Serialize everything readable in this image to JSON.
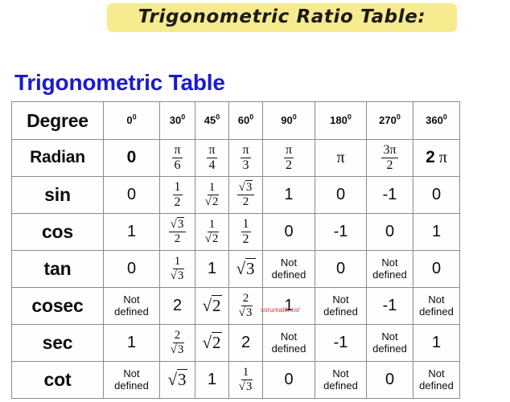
{
  "banner": {
    "title": "Trigonometric Ratio Table:",
    "highlight_color": "#f6eb8f"
  },
  "heading": {
    "text": "Trigonometric Table",
    "color": "#1a1ad0"
  },
  "watermark": {
    "text": "sorumatik.co/",
    "color": "#d4313b"
  },
  "table": {
    "columns": [
      {
        "label": "Degree",
        "value": "",
        "sup": ""
      },
      {
        "label": "0",
        "sup": "0"
      },
      {
        "label": "30",
        "sup": "0"
      },
      {
        "label": "45",
        "sup": "0"
      },
      {
        "label": "60",
        "sup": "0"
      },
      {
        "label": "90",
        "sup": "0"
      },
      {
        "label": "180",
        "sup": "0"
      },
      {
        "label": "270",
        "sup": "0"
      },
      {
        "label": "360",
        "sup": "0"
      }
    ],
    "rows": [
      {
        "label": "Radian",
        "cells": [
          {
            "kind": "plain-bold",
            "text": "0"
          },
          {
            "kind": "frac",
            "num": "π",
            "den": "6"
          },
          {
            "kind": "frac",
            "num": "π",
            "den": "4"
          },
          {
            "kind": "frac",
            "num": "π",
            "den": "3"
          },
          {
            "kind": "frac",
            "num": "π",
            "den": "2"
          },
          {
            "kind": "pi",
            "text": "π"
          },
          {
            "kind": "frac",
            "num": "3π",
            "den": "2"
          },
          {
            "kind": "twopi",
            "text": "2",
            "pi": "π"
          }
        ]
      },
      {
        "label": "sin",
        "cells": [
          {
            "kind": "plain",
            "text": "0"
          },
          {
            "kind": "frac",
            "num": "1",
            "den": "2"
          },
          {
            "kind": "frac-radical-den",
            "num": "1",
            "den": "2"
          },
          {
            "kind": "frac-radical-num",
            "num": "3",
            "den": "2"
          },
          {
            "kind": "plain",
            "text": "1"
          },
          {
            "kind": "plain",
            "text": "0"
          },
          {
            "kind": "plain",
            "text": "-1"
          },
          {
            "kind": "plain",
            "text": "0"
          }
        ]
      },
      {
        "label": "cos",
        "cells": [
          {
            "kind": "plain",
            "text": "1"
          },
          {
            "kind": "frac-radical-num",
            "num": "3",
            "den": "2"
          },
          {
            "kind": "frac-radical-den",
            "num": "1",
            "den": "2"
          },
          {
            "kind": "frac",
            "num": "1",
            "den": "2"
          },
          {
            "kind": "plain",
            "text": "0"
          },
          {
            "kind": "plain",
            "text": "-1"
          },
          {
            "kind": "plain",
            "text": "0"
          },
          {
            "kind": "plain",
            "text": "1"
          }
        ]
      },
      {
        "label": "tan",
        "cells": [
          {
            "kind": "plain",
            "text": "0"
          },
          {
            "kind": "frac-radical-den",
            "num": "1",
            "den": "3"
          },
          {
            "kind": "plain",
            "text": "1"
          },
          {
            "kind": "radical",
            "text": "3"
          },
          {
            "kind": "notdef",
            "line1": "Not",
            "line2": "defined"
          },
          {
            "kind": "plain",
            "text": "0"
          },
          {
            "kind": "notdef",
            "line1": "Not",
            "line2": "defined"
          },
          {
            "kind": "plain",
            "text": "0"
          }
        ]
      },
      {
        "label": "cosec",
        "cells": [
          {
            "kind": "notdef",
            "line1": "Not",
            "line2": "defined"
          },
          {
            "kind": "plain",
            "text": "2"
          },
          {
            "kind": "radical",
            "text": "2"
          },
          {
            "kind": "frac-radical-den",
            "num": "2",
            "den": "3"
          },
          {
            "kind": "plain",
            "text": "1"
          },
          {
            "kind": "notdef",
            "line1": "Not",
            "line2": "defined"
          },
          {
            "kind": "plain",
            "text": "-1"
          },
          {
            "kind": "notdef",
            "line1": "Not",
            "line2": "defined"
          }
        ]
      },
      {
        "label": "sec",
        "cells": [
          {
            "kind": "plain",
            "text": "1"
          },
          {
            "kind": "frac-radical-den",
            "num": "2",
            "den": "3"
          },
          {
            "kind": "radical",
            "text": "2"
          },
          {
            "kind": "plain",
            "text": "2"
          },
          {
            "kind": "notdef",
            "line1": "Not",
            "line2": "defined"
          },
          {
            "kind": "plain",
            "text": "-1"
          },
          {
            "kind": "notdef",
            "line1": "Not",
            "line2": "defined"
          },
          {
            "kind": "plain",
            "text": "1"
          }
        ]
      },
      {
        "label": "cot",
        "cells": [
          {
            "kind": "notdef",
            "line1": "Not",
            "line2": "defined"
          },
          {
            "kind": "radical",
            "text": "3"
          },
          {
            "kind": "plain",
            "text": "1"
          },
          {
            "kind": "frac-radical-den",
            "num": "1",
            "den": "3"
          },
          {
            "kind": "plain",
            "text": "0"
          },
          {
            "kind": "notdef",
            "line1": "Not",
            "line2": "defined"
          },
          {
            "kind": "plain",
            "text": "0"
          },
          {
            "kind": "notdef",
            "line1": "Not",
            "line2": "defined"
          }
        ]
      }
    ]
  }
}
